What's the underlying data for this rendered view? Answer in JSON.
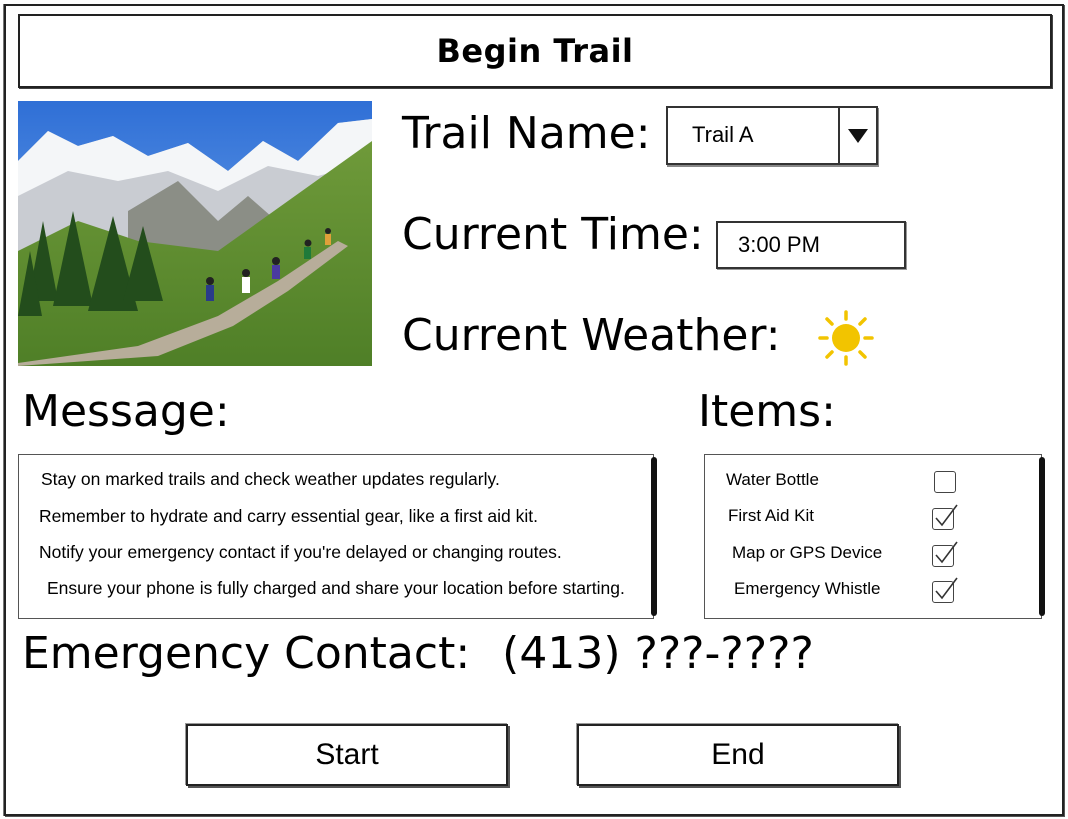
{
  "title": "Begin Trail",
  "trail": {
    "label": "Trail Name:",
    "selected": "Trail A"
  },
  "time": {
    "label": "Current Time:",
    "value": "3:00 PM"
  },
  "weather": {
    "label": "Current Weather:",
    "icon": "sun-icon",
    "icon_color": "#f2c400"
  },
  "message": {
    "label": "Message:",
    "lines": [
      "Stay on marked trails and check weather updates regularly.",
      "Remember to hydrate and carry essential gear, like a first aid kit.",
      "Notify your emergency contact if you're delayed or changing routes.",
      "Ensure your phone is fully charged and share your location before starting."
    ]
  },
  "items": {
    "label": "Items:",
    "list": [
      {
        "name": "Water Bottle",
        "checked": false
      },
      {
        "name": "First Aid Kit",
        "checked": true
      },
      {
        "name": "Map or GPS Device",
        "checked": true
      },
      {
        "name": "Emergency Whistle",
        "checked": true
      }
    ]
  },
  "emergency": {
    "label": "Emergency Contact:",
    "number": "(413) ???-????"
  },
  "buttons": {
    "start": "Start",
    "end": "End"
  }
}
